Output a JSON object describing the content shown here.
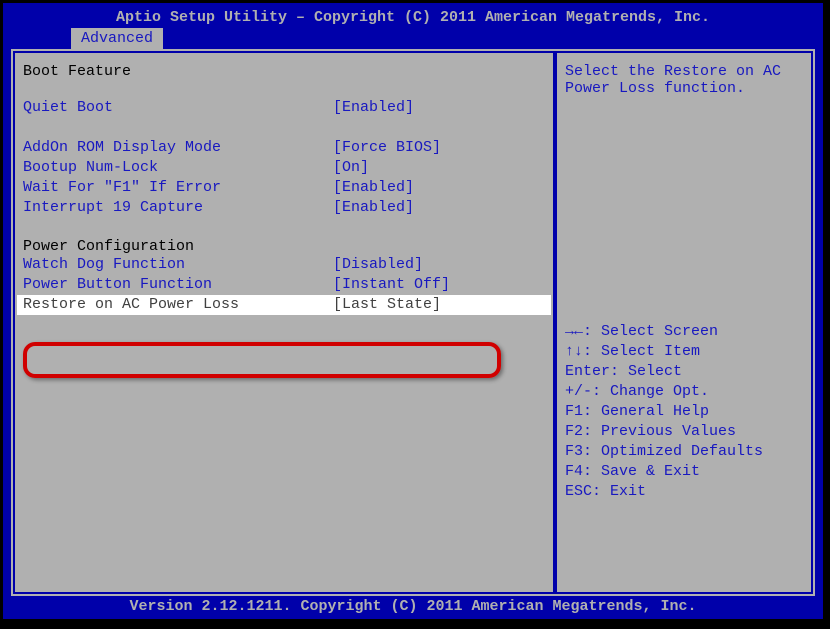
{
  "header": {
    "title": "Aptio Setup Utility – Copyright (C) 2011 American Megatrends, Inc."
  },
  "tabs": {
    "active": "Advanced"
  },
  "main": {
    "section1": "Boot Feature",
    "items1": [
      {
        "label": "Quiet Boot",
        "value": "[Enabled]"
      }
    ],
    "items2": [
      {
        "label": "AddOn ROM Display Mode",
        "value": "[Force BIOS]"
      },
      {
        "label": "Bootup Num-Lock",
        "value": "[On]"
      },
      {
        "label": "Wait For \"F1\" If Error",
        "value": "[Enabled]"
      },
      {
        "label": "Interrupt 19 Capture",
        "value": "[Enabled]"
      }
    ],
    "section2": "Power Configuration",
    "items3": [
      {
        "label": "Watch Dog Function",
        "value": "[Disabled]"
      },
      {
        "label": "Power Button Function",
        "value": "[Instant Off]"
      }
    ],
    "selected": {
      "label": "Restore on AC Power Loss",
      "value": "[Last State]"
    }
  },
  "side": {
    "help": "Select the Restore on AC Power Loss function.",
    "keys": [
      "→←: Select Screen",
      "↑↓: Select Item",
      "Enter: Select",
      "+/-: Change Opt.",
      "F1: General Help",
      "F2: Previous Values",
      "F3: Optimized Defaults",
      "F4: Save & Exit",
      "ESC: Exit"
    ]
  },
  "footer": {
    "text": "Version 2.12.1211. Copyright (C) 2011 American Megatrends, Inc."
  }
}
